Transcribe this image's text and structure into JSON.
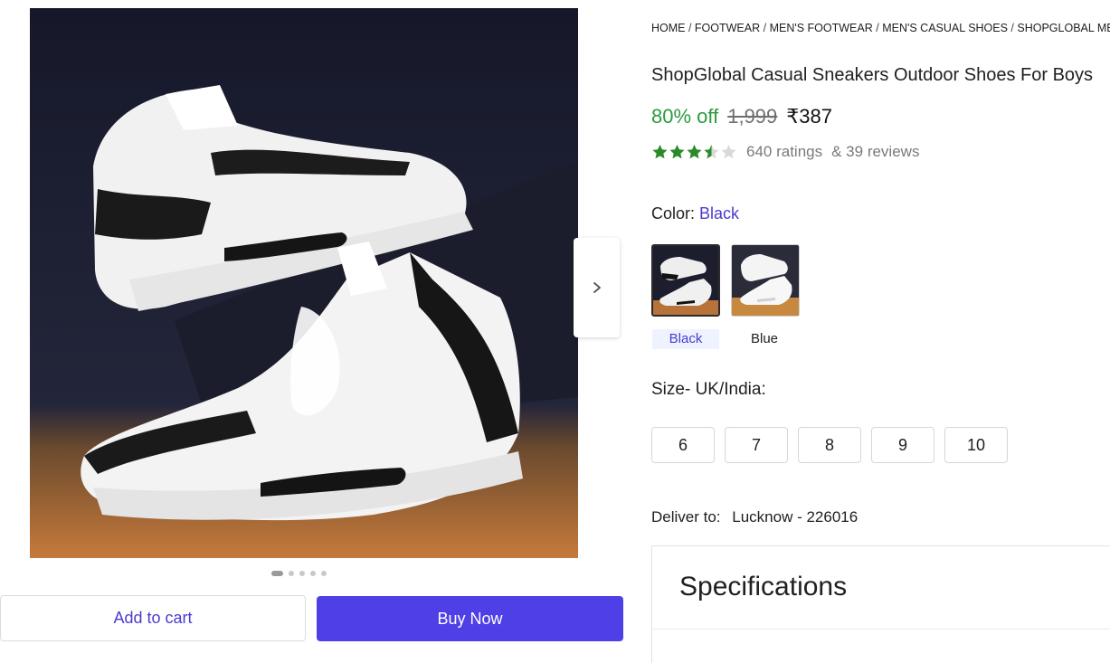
{
  "breadcrumb": [
    "HOME",
    "FOOTWEAR",
    "MEN'S FOOTWEAR",
    "MEN'S CASUAL SHOES",
    "SHOPGLOBAL MEN'S CASUAL SHOES"
  ],
  "product": {
    "title": "ShopGlobal Casual Sneakers Outdoor Shoes For Boys",
    "discount": "80% off",
    "mrp": "1,999",
    "price": "₹387",
    "rating": 3.5,
    "ratings_text": "640 ratings",
    "reviews_text": "& 39 reviews"
  },
  "color": {
    "label": "Color:",
    "selected": "Black",
    "options": [
      "Black",
      "Blue"
    ]
  },
  "size": {
    "label": "Size- UK/India:",
    "options": [
      "6",
      "7",
      "8",
      "9",
      "10"
    ]
  },
  "delivery": {
    "label": "Deliver to:",
    "location": "Lucknow - 226016"
  },
  "specifications": {
    "title": "Specifications"
  },
  "gallery": {
    "image_count": 5,
    "active_index": 0
  },
  "actions": {
    "add_to_cart": "Add to cart",
    "buy_now": "Buy Now"
  },
  "colors": {
    "accent": "#4f3fe6",
    "discount": "#2c9a3f",
    "star": "#2a8a2a"
  },
  "icons": {
    "next": "chevron-right-icon",
    "star": "star-icon"
  }
}
